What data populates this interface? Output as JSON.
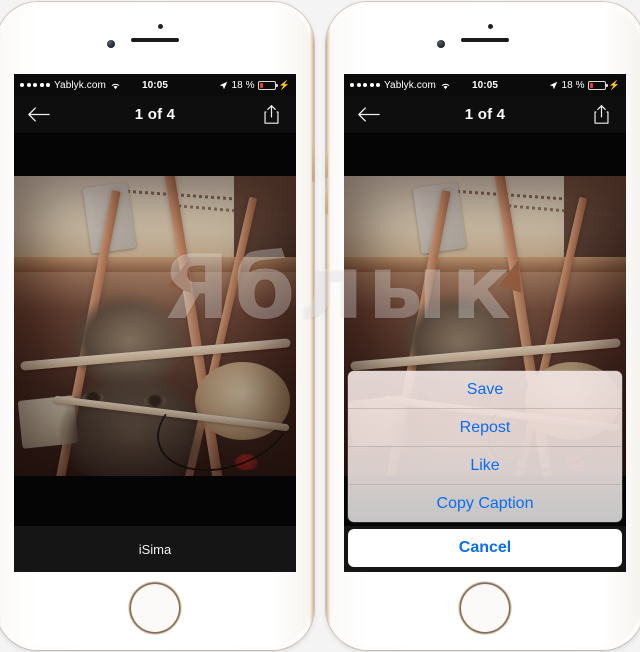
{
  "meta": {
    "watermark_text": "Яблык"
  },
  "status_bar": {
    "signal_dots": 5,
    "carrier": "Yablyk.com",
    "wifi_icon": "wifi-icon",
    "time": "10:05",
    "location_icon": "location-arrow-icon",
    "battery_percent": "18 %",
    "battery_level": 18,
    "battery_color": "#e8402a",
    "charging_icon": "lightning-bolt-icon"
  },
  "nav_bar": {
    "back_icon": "back-arrow-icon",
    "title": "1 of 4",
    "share_icon": "share-icon"
  },
  "photo": {
    "caption": "iSima"
  },
  "action_sheet": {
    "accent_color": "#0a6cf0",
    "options": [
      {
        "label": "Save"
      },
      {
        "label": "Repost"
      },
      {
        "label": "Like"
      },
      {
        "label": "Copy Caption"
      }
    ],
    "cancel_label": "Cancel"
  }
}
